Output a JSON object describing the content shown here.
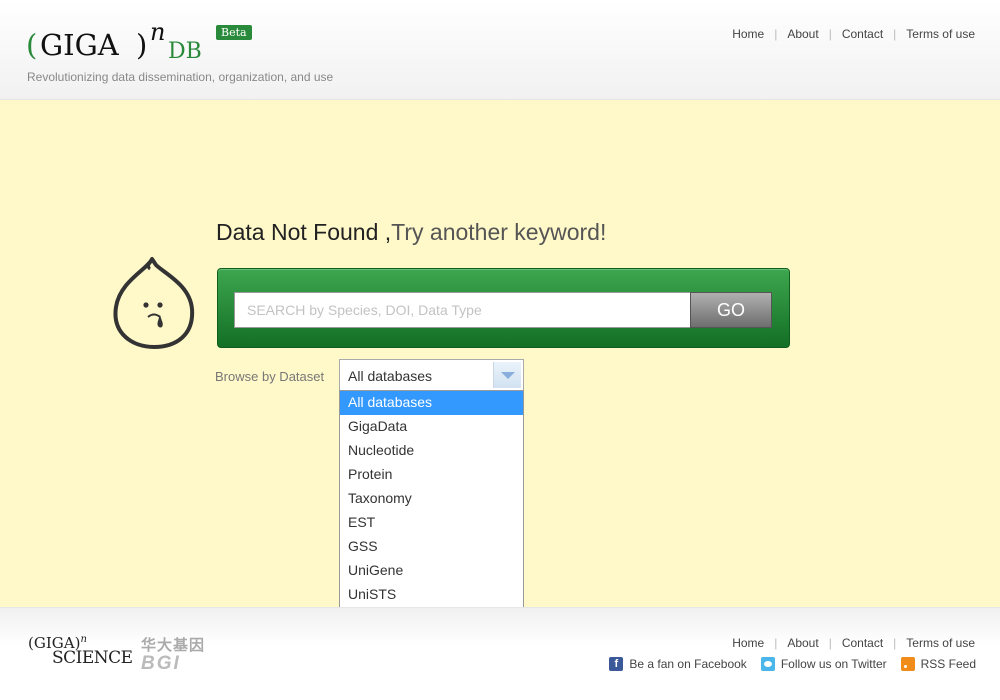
{
  "header": {
    "logo": {
      "paren_left": "(",
      "giga": "GIGA",
      "paren_right": ")",
      "superscript": "n",
      "db": "DB",
      "badge": "Beta"
    },
    "tagline": "Revolutionizing data dissemination, organization, and use",
    "nav": [
      "Home",
      "About",
      "Contact",
      "Terms of use"
    ]
  },
  "main": {
    "title": "Data Not Found ,",
    "title_sub": "Try another keyword!",
    "search": {
      "placeholder": "SEARCH by Species, DOI, Data Type",
      "button": "GO"
    },
    "browse_label": "Browse by Dataset",
    "select_value": "All databases",
    "dropdown_options": [
      "All databases",
      "GigaData",
      "Nucleotide",
      "Protein",
      "Taxonomy",
      "EST",
      "GSS",
      "UniGene",
      "UniSTS"
    ],
    "selected_index": 0
  },
  "footer": {
    "logo1": {
      "giga": "(GIGA)",
      "n": "n",
      "science": "SCIENCE"
    },
    "logo2": {
      "cn": "华大基因",
      "bgi": "BGI"
    },
    "nav": [
      "Home",
      "About",
      "Contact",
      "Terms of use"
    ],
    "social": [
      {
        "icon": "facebook-icon",
        "label": "Be a fan on Facebook"
      },
      {
        "icon": "twitter-icon",
        "label": "Follow us on Twitter"
      },
      {
        "icon": "rss-icon",
        "label": "RSS Feed"
      }
    ]
  },
  "colors": {
    "brand_green": "#2a8a3c",
    "background_yellow": "#fff8c9",
    "selected_blue": "#3399ff"
  }
}
